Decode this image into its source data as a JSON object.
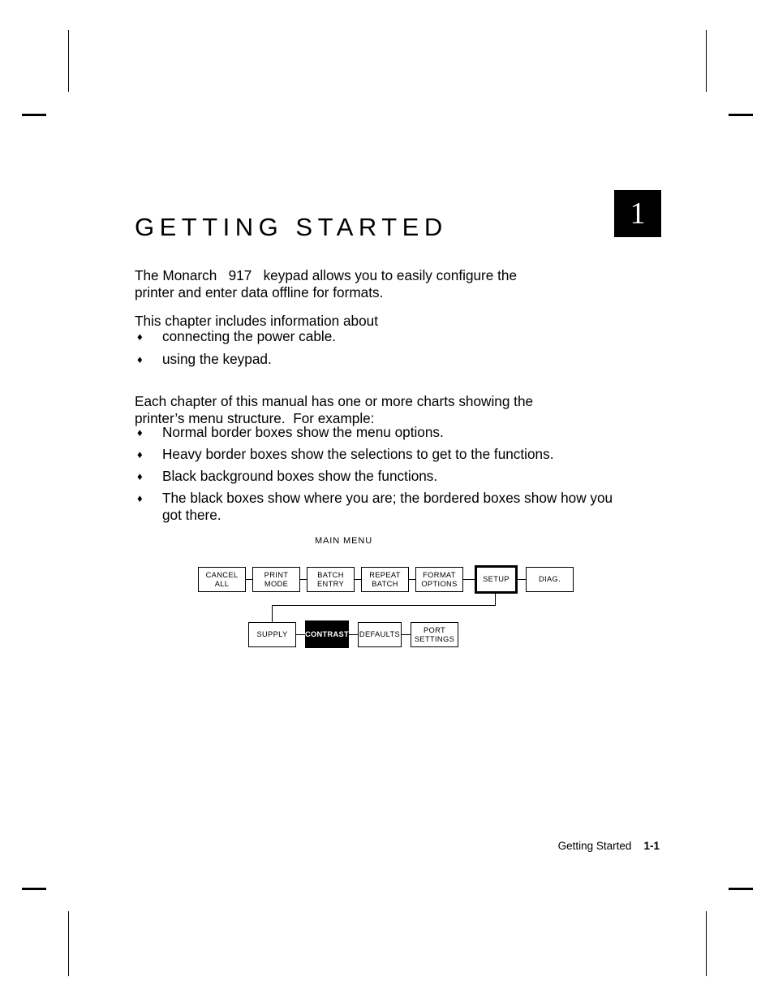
{
  "document": {
    "chapter_title": "GETTING STARTED",
    "chapter_badge": "1",
    "intro_paragraph": "The Monarch   917   keypad allows you to easily configure the\nprinter and enter data offline for formats.",
    "includes_paragraph": "This chapter includes information about",
    "topics": [
      "connecting the power cable.",
      "using the keypad."
    ],
    "charts_paragraph": "Each chapter of this manual has one or more charts showing the\nprinter’s menu structure.  For example:",
    "legend_items": [
      "Normal border boxes show the menu options.",
      "Heavy border boxes show the selections to get to the functions.",
      "Black background boxes show the functions.",
      "The black boxes show where you are; the bordered boxes show how you\ngot there."
    ],
    "bullet_glyph": "♦",
    "footer": {
      "section_label": "Getting Started",
      "page_number": "1-1"
    }
  },
  "menu_chart": {
    "caption": "MAIN MENU",
    "main_menu_boxes": [
      {
        "label": "CANCEL\nALL",
        "style": "normal"
      },
      {
        "label": "PRINT\nMODE",
        "style": "normal"
      },
      {
        "label": "BATCH\nENTRY",
        "style": "normal"
      },
      {
        "label": "REPEAT\nBATCH",
        "style": "normal"
      },
      {
        "label": "FORMAT\nOPTIONS",
        "style": "normal"
      },
      {
        "label": "SETUP",
        "style": "heavy"
      },
      {
        "label": "DIAG.",
        "style": "normal"
      }
    ],
    "setup_submenu_boxes": [
      {
        "label": "SUPPLY",
        "style": "normal"
      },
      {
        "label": "CONTRAST",
        "style": "filled"
      },
      {
        "label": "DEFAULTS",
        "style": "normal"
      },
      {
        "label": "PORT\nSETTINGS",
        "style": "normal"
      }
    ]
  },
  "colors": {
    "ink": "#000000",
    "paper": "#ffffff",
    "highlight_fill": "#000000",
    "highlight_text": "#ffffff"
  }
}
